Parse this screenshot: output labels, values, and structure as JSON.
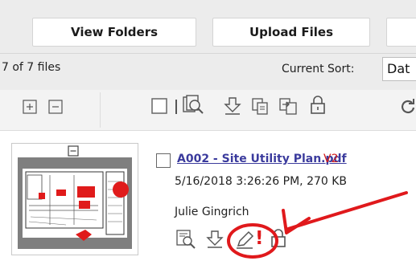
{
  "header": {
    "view_folders": "View Folders",
    "upload_files": "Upload Files"
  },
  "listing": {
    "count": "7 of 7 files",
    "sort_label": "Current Sort:",
    "sort_value": "Dat"
  },
  "toolbar": {
    "icons": [
      "expand-icon",
      "collapse-icon",
      "select-all-checkbox",
      "separator",
      "preview-icon",
      "download-icon",
      "copy-icon",
      "move-icon",
      "lock-icon",
      "refresh-icon"
    ]
  },
  "file": {
    "name": "A002 - Site Utility Plan.pdf",
    "version": "V2",
    "modified": "5/16/2018 3:26:26 PM, 270 KB",
    "owner": "Julie Gingrich",
    "actions": [
      "preview-icon",
      "download-icon",
      "edit-icon",
      "lock-icon"
    ]
  },
  "annotation": {
    "mark": "!",
    "color": "#e0191c"
  }
}
